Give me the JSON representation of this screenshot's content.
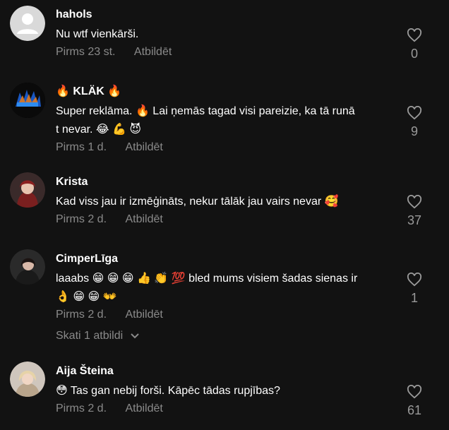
{
  "comments": [
    {
      "username": "hahols",
      "lines": [
        "Nu wtf vienkārši.",
        ""
      ],
      "time": "Pirms 23 st.",
      "reply": "Atbildēt",
      "likes": "0",
      "avatar": "default-avatar"
    },
    {
      "username": "🔥 KLÄK 🔥",
      "lines": [
        "Super reklāma. 🔥 Lai ņemās tagad visi pareizie, ka tā runā",
        "t nevar. 😂 💪 😈"
      ],
      "time": "Pirms 1 d.",
      "reply": "Atbildēt",
      "likes": "9",
      "avatar": "klak-logo-avatar"
    },
    {
      "username": "Krista",
      "lines": [
        "Kad viss jau ir izmēģināts, nekur tālāk jau vairs nevar 🥰",
        ""
      ],
      "time": "Pirms 2 d.",
      "reply": "Atbildēt",
      "likes": "37",
      "avatar": "photo-avatar"
    },
    {
      "username": "CimperLīga",
      "lines": [
        "laaabs 😁 😁 😁 👍 👏 💯  bled mums visiem šadas sienas ir",
        "👌 😁 😁 👐"
      ],
      "time": "Pirms 2 d.",
      "reply": "Atbildēt",
      "likes": "1",
      "view_replies": "Skati 1 atbildi",
      "avatar": "photo-avatar"
    },
    {
      "username": "Aija Šteina",
      "lines": [
        "😳 Tas gan nebij forši. Kāpēc tādas rupjības?",
        ""
      ],
      "time": "Pirms 2 d.",
      "reply": "Atbildēt",
      "likes": "61",
      "avatar": "photo-avatar"
    }
  ],
  "icons": {
    "like": "heart-outline-icon",
    "expand": "chevron-down-icon"
  },
  "colors": {
    "background": "#121212",
    "text": "#ffffff",
    "muted": "#8a8a8a"
  }
}
